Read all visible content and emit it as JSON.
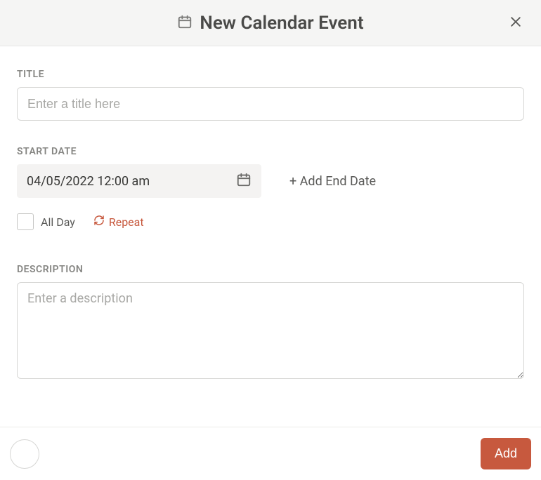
{
  "header": {
    "title": "New Calendar Event"
  },
  "form": {
    "title_label": "TITLE",
    "title_placeholder": "Enter a title here",
    "title_value": "",
    "start_date_label": "START DATE",
    "start_date_value": "04/05/2022 12:00 am",
    "add_end_date_label": "+ Add End Date",
    "all_day_label": "All Day",
    "all_day_checked": false,
    "repeat_label": "Repeat",
    "description_label": "DESCRIPTION",
    "description_placeholder": "Enter a description",
    "description_value": ""
  },
  "footer": {
    "add_button_label": "Add"
  }
}
